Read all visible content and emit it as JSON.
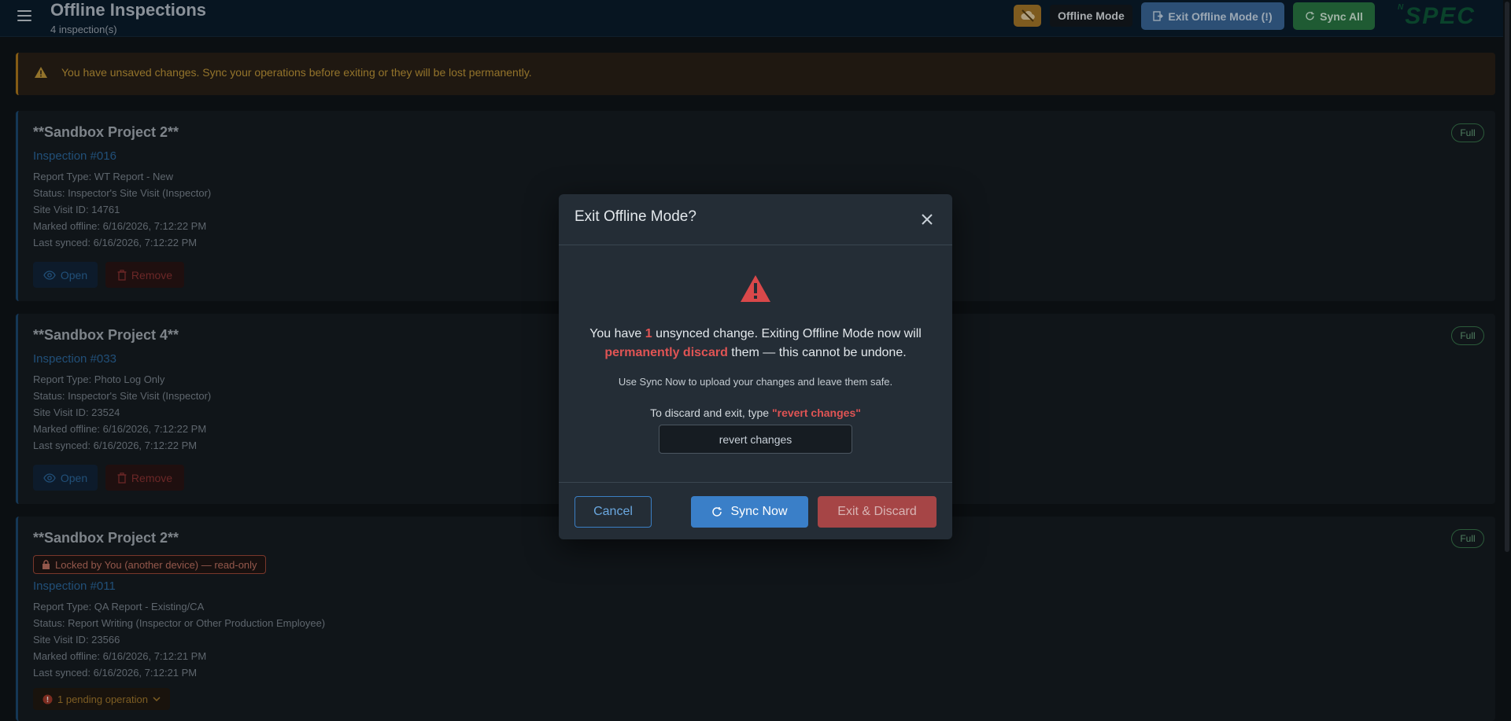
{
  "header": {
    "title": "Offline Inspections",
    "subtitle": "4 inspection(s)",
    "offline_mode_label": "Offline Mode",
    "exit_offline_label": "Exit Offline Mode (!)",
    "sync_all_label": "Sync All",
    "logo_text": "SPEC",
    "logo_sup": "N"
  },
  "banner": {
    "text": "You have unsaved changes. Sync your operations before exiting or they will be lost permanently."
  },
  "cards": [
    {
      "project": "**Sandbox Project 2**",
      "inspection": "Inspection #016",
      "report_type": "Report Type: WT Report - New",
      "status": "Status: Inspector's Site Visit (Inspector)",
      "site_visit": "Site Visit ID: 14761",
      "marked_offline": "Marked offline: 6/16/2026, 7:12:22 PM",
      "last_synced": "Last synced: 6/16/2026, 7:12:22 PM",
      "badge": "Full",
      "open_label": "Open",
      "remove_label": "Remove"
    },
    {
      "project": "**Sandbox Project 4**",
      "inspection": "Inspection #033",
      "report_type": "Report Type: Photo Log Only",
      "status": "Status: Inspector's Site Visit (Inspector)",
      "site_visit": "Site Visit ID: 23524",
      "marked_offline": "Marked offline: 6/16/2026, 7:12:22 PM",
      "last_synced": "Last synced: 6/16/2026, 7:12:22 PM",
      "badge": "Full",
      "open_label": "Open",
      "remove_label": "Remove"
    },
    {
      "project": "**Sandbox Project 2**",
      "locked": "Locked by You (another device) — read-only",
      "inspection": "Inspection #011",
      "report_type": "Report Type: QA Report - Existing/CA",
      "status": "Status: Report Writing (Inspector or Other Production Employee)",
      "site_visit": "Site Visit ID: 23566",
      "marked_offline": "Marked offline: 6/16/2026, 7:12:21 PM",
      "last_synced": "Last synced: 6/16/2026, 7:12:21 PM",
      "badge": "Full",
      "pending": "1 pending operation"
    }
  ],
  "modal": {
    "title": "Exit Offline Mode?",
    "msg_part1": "You have ",
    "msg_count": "1",
    "msg_part2": " unsynced change. Exiting Offline Mode now will",
    "msg_discard": "permanently discard",
    "msg_part3": " them — this cannot be undone.",
    "hint": "Use Sync Now to upload your changes and leave them safe.",
    "type_prompt": "To discard and exit, type ",
    "type_phrase": "\"revert changes\"",
    "input_value": "revert changes",
    "cancel_label": "Cancel",
    "sync_now_label": "Sync Now",
    "discard_label": "Exit & Discard"
  },
  "colors": {
    "accent_blue": "#3a7fc8",
    "danger_red": "#e05454",
    "warning_amber": "#b07a1c",
    "success_green": "#2a7a45"
  }
}
